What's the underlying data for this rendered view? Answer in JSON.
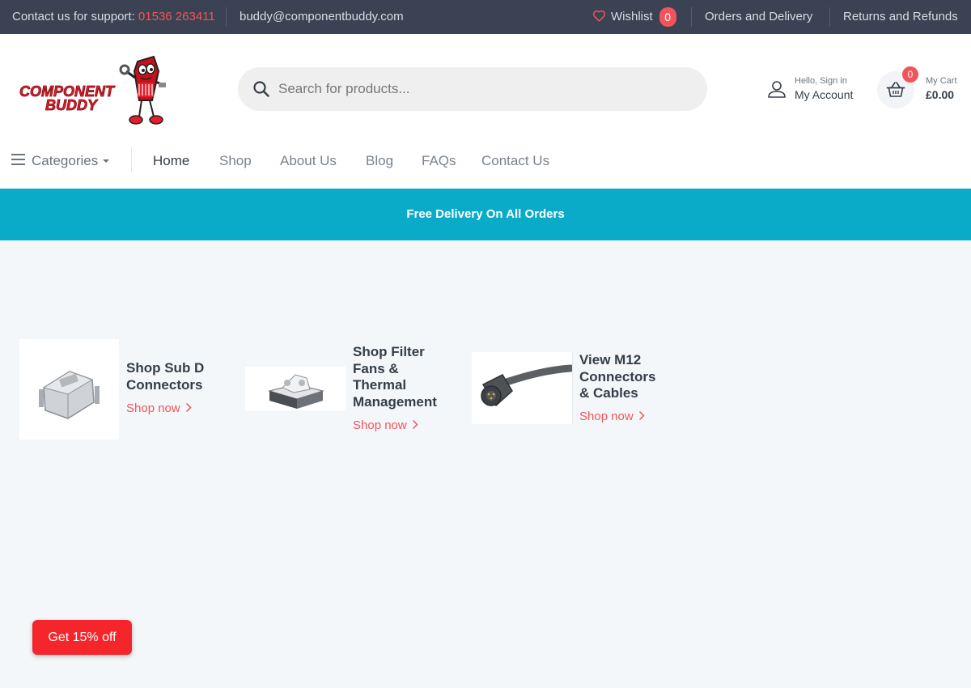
{
  "topbar": {
    "support_label": "Contact us for support:",
    "support_phone": "01536 263411",
    "email": "buddy@componentbuddy.com",
    "wishlist_label": "Wishlist",
    "wishlist_count": "0",
    "orders_link": "Orders and Delivery",
    "returns_link": "Returns and Refunds"
  },
  "header": {
    "logo_line1": "COMPONENT",
    "logo_line2": "BUDDY",
    "search_placeholder": "Search for products...",
    "account_greeting": "Hello, Sign in",
    "account_label": "My Account",
    "cart_label": "My Cart",
    "cart_total": "£0.00",
    "cart_count": "0"
  },
  "nav": {
    "categories_label": "Categories",
    "links": [
      "Home",
      "Shop",
      "About Us",
      "Blog",
      "FAQs",
      "Contact Us"
    ],
    "active": "Home"
  },
  "banner": {
    "text": "Free Delivery On All Orders"
  },
  "promos": [
    {
      "title_lines": [
        "Shop Sub D",
        "Connectors"
      ],
      "cta": "Shop now"
    },
    {
      "title_lines": [
        "Shop Filter",
        "Fans &",
        "Thermal",
        "Management"
      ],
      "cta": "Shop now"
    },
    {
      "title_lines": [
        "View M12",
        "Connectors",
        "& Cables"
      ],
      "cta": "Shop now"
    }
  ],
  "discount_button": "Get 15% off",
  "colors": {
    "topbar_bg": "#3a4253",
    "accent_red": "#f2545b",
    "banner_bg": "#0aabc9",
    "page_bg": "#f4f7fa",
    "discount_bg": "#f4262b"
  }
}
